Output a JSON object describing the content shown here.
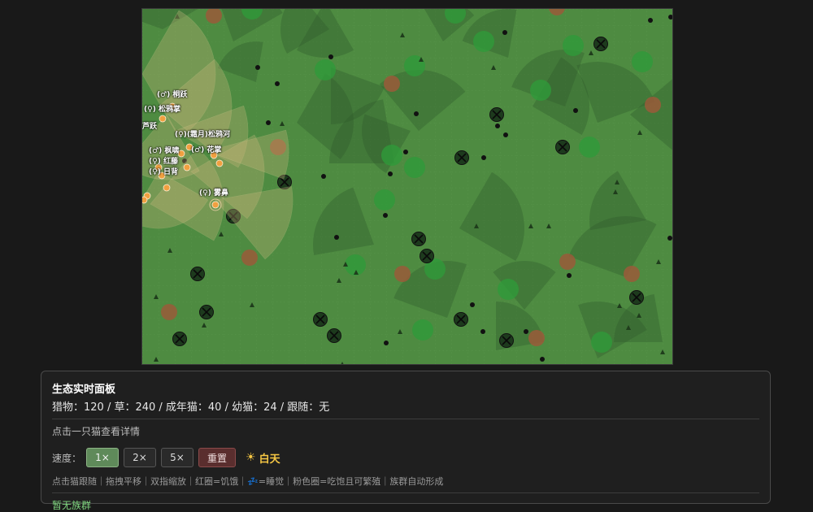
{
  "map": {
    "colors": {
      "grass": "#4e8b41",
      "bush": "#2f9a3a",
      "dirt": "#9a5a3a",
      "prey": "#111111",
      "dead": "#1d3a1d",
      "vision": "#c9b67a",
      "cat": "#f0a040"
    },
    "cat_labels": [
      "(♂) 桐跃",
      "(♀)(霜月)松鸦河",
      "(♂) 花掌",
      "(♂) 枫啸",
      "(♀) 红藤",
      "(♀) 日背",
      "(♀) 雾鼻",
      "芦跃",
      "(♀) 松鸦掌"
    ]
  },
  "panel": {
    "title": "生态实时面板",
    "stats": "猎物：120 / 草：240 / 成年猫：40 / 幼猫：24 / 跟随：无",
    "hint": "点击一只猫查看详情",
    "speed_label": "速度：",
    "buttons": {
      "x1": "1×",
      "x2": "2×",
      "x5": "5×",
      "reset": "重置"
    },
    "daytime": "白天",
    "sun_icon": "☀",
    "legend": "点击猫跟随｜拖拽平移｜双指缩放｜红圈=饥饿｜💤=睡觉｜粉色圈=吃饱且可繁殖｜族群自动形成",
    "clan_status": "暂无族群"
  }
}
